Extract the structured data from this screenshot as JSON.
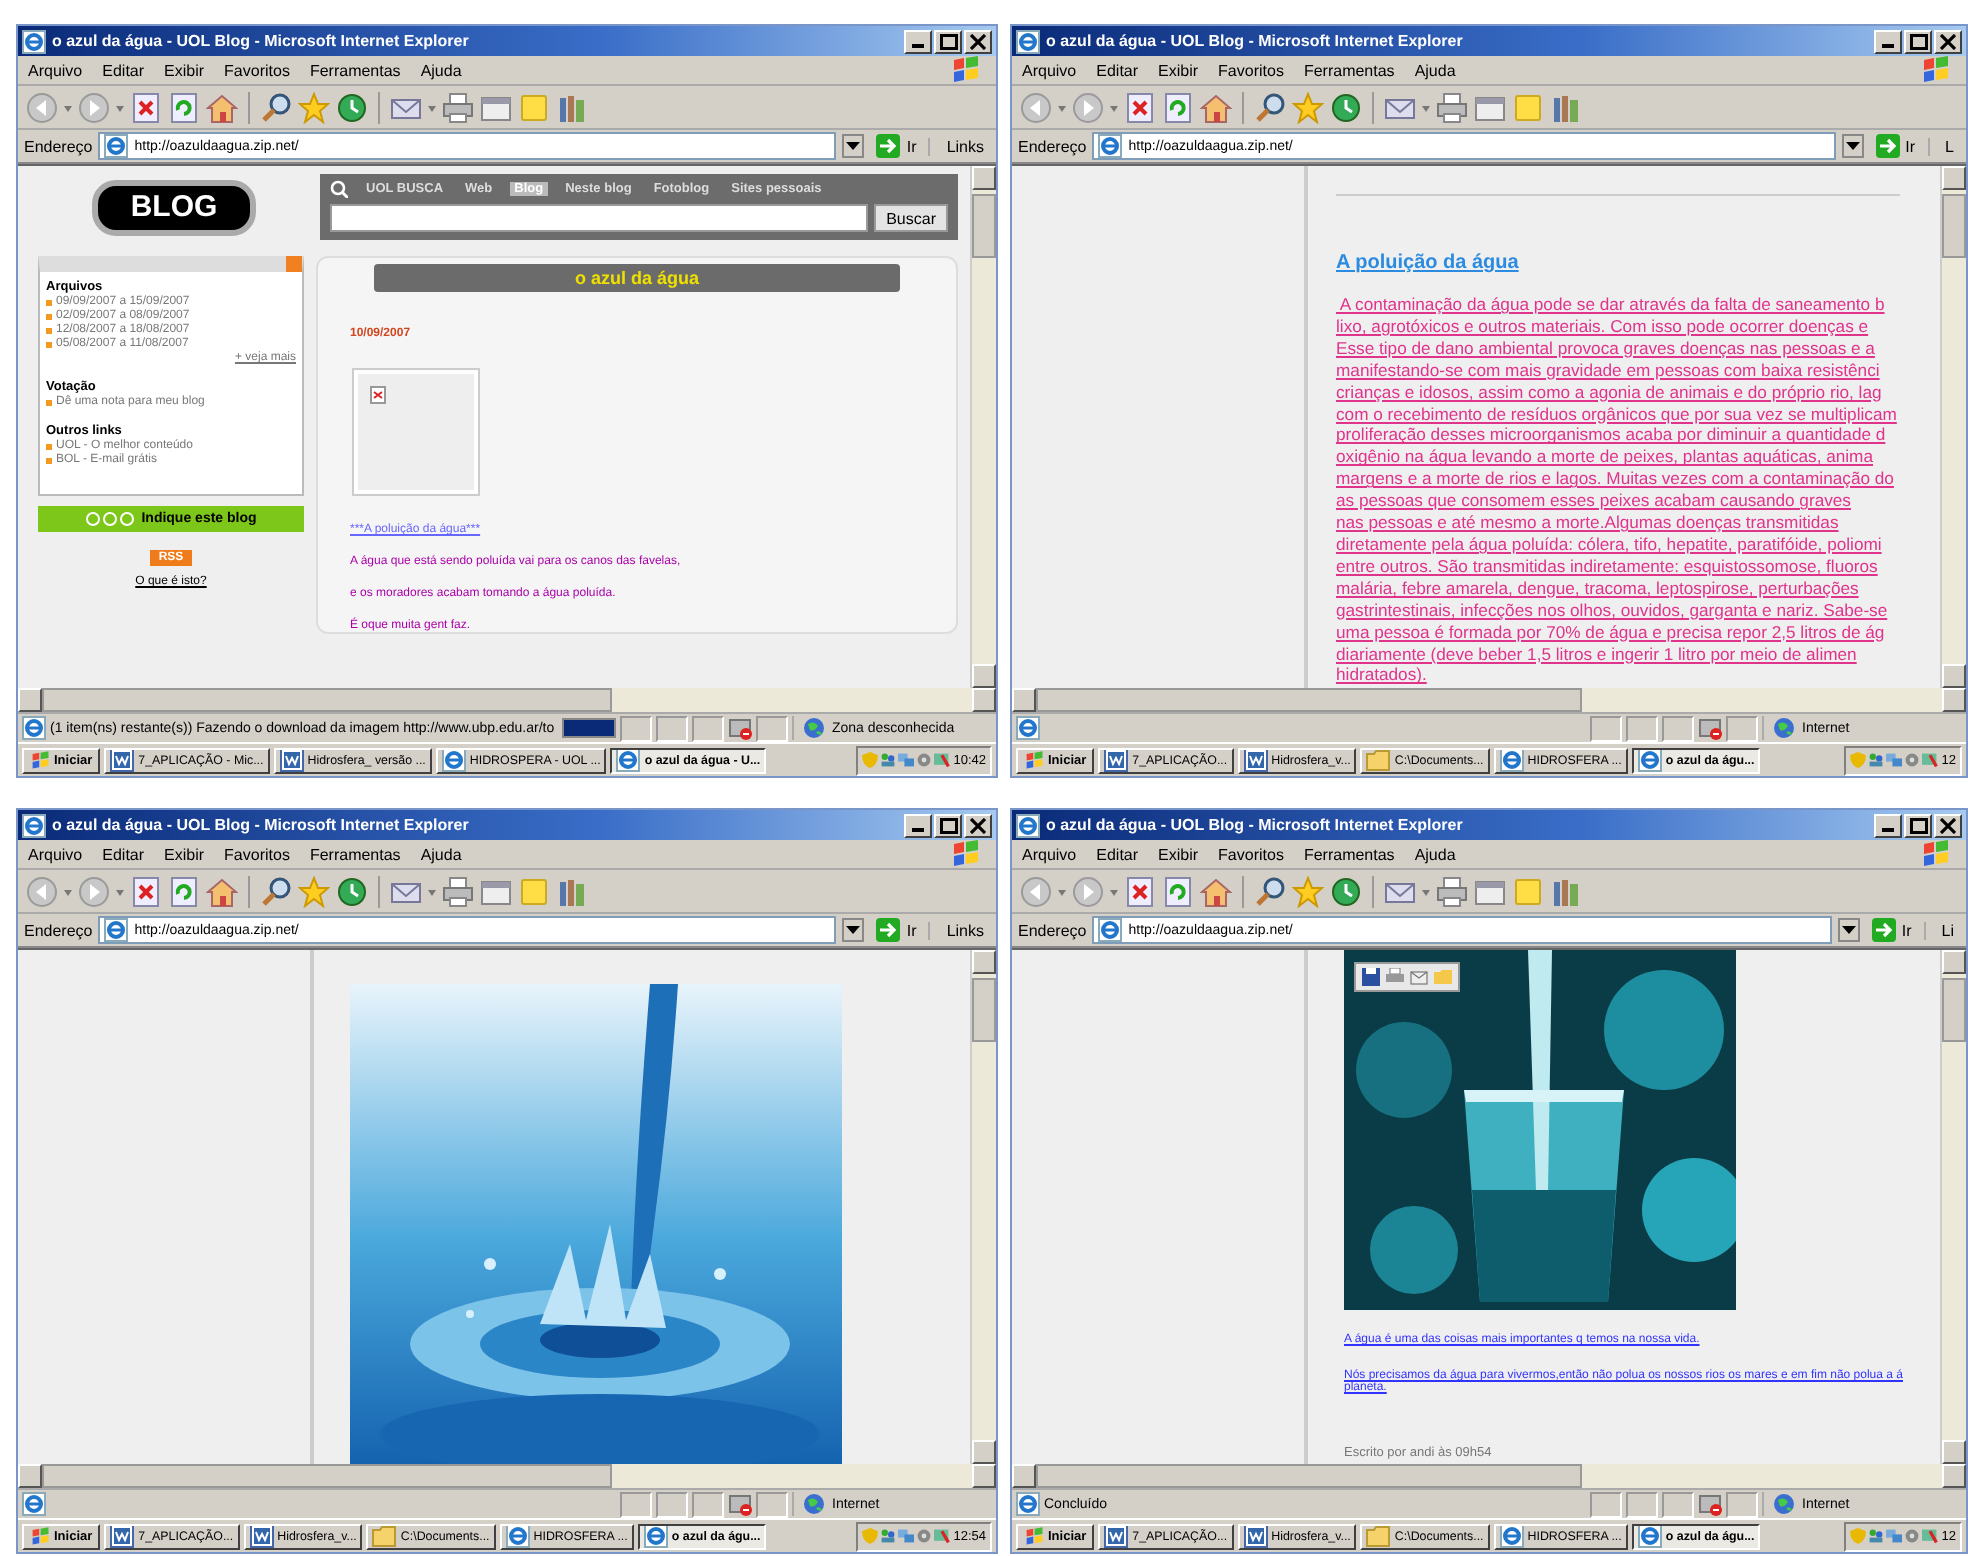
{
  "windows": [
    {
      "title": "o azul da água - UOL Blog - Microsoft Internet Explorer",
      "menu": [
        "Arquivo",
        "Editar",
        "Exibir",
        "Favoritos",
        "Ferramentas",
        "Ajuda"
      ],
      "address_label": "Endereço",
      "url": "http://oazuldaagua.zip.net/",
      "go": "Ir",
      "links": "Links",
      "page": {
        "kind": "blog_home",
        "logo": "BLOG",
        "search": {
          "tabs": [
            {
              "label": "UOL BUSCA",
              "selected": false
            },
            {
              "label": "Web",
              "selected": false
            },
            {
              "label": "Blog",
              "selected": true
            },
            {
              "label": "Neste blog",
              "selected": false
            },
            {
              "label": "Fotoblog",
              "selected": false
            },
            {
              "label": "Sites pessoais",
              "selected": false
            }
          ],
          "button": "Buscar"
        },
        "sidebar": [
          {
            "heading": "Arquivos",
            "items": [
              "09/09/2007 a 15/09/2007",
              "02/09/2007 a 08/09/2007",
              "12/08/2007 a 18/08/2007",
              "05/08/2007 a 11/08/2007"
            ],
            "more": "+ veja mais"
          },
          {
            "heading": "Votação",
            "items": [
              "Dê uma nota para meu blog"
            ]
          },
          {
            "heading": "Outros links",
            "items": [
              "UOL - O melhor conteúdo",
              "BOL - E-mail grátis"
            ]
          }
        ],
        "recommend": "Indique este blog",
        "rss": "RSS",
        "rss_help": "O que é isto?",
        "blog_title": "o azul da água",
        "post": {
          "date": "10/09/2007",
          "link": "***A poluição da água***",
          "paragraphs": [
            "A água que está sendo poluída vai para os canos das favelas,",
            "e os moradores acabam tomando a água poluída.",
            "É oque muita gent faz."
          ]
        }
      },
      "status": {
        "text": "(1 item(ns) restante(s)) Fazendo o download da imagem http://www.ubp.edu.ar/to",
        "progress": {
          "level": 1
        },
        "zone": "Zona desconhecida"
      },
      "taskbar": {
        "start": "Iniciar",
        "items": [
          {
            "label": "7_APLICAÇÃO - Mic...",
            "kind": "word",
            "selected": false
          },
          {
            "label": "Hidrosfera_ versão ...",
            "kind": "word",
            "selected": false
          },
          {
            "label": "HIDROSPERA - UOL ...",
            "kind": "ie",
            "selected": false
          },
          {
            "label": "o azul da água - U...",
            "kind": "ie",
            "selected": true
          }
        ],
        "clock": "10:42"
      }
    },
    {
      "title": "o azul da água - UOL Blog - Microsoft Internet Explorer",
      "menu": [
        "Arquivo",
        "Editar",
        "Exibir",
        "Favoritos",
        "Ferramentas",
        "Ajuda"
      ],
      "address_label": "Endereço",
      "url": "http://oazuldaagua.zip.net/",
      "go": "Ir",
      "links": "L",
      "page": {
        "kind": "article",
        "heading": "A poluição da água",
        "lines": [
          " A contaminação da água pode se dar através da falta de saneamento b",
          "lixo, agrotóxicos e outros materiais. Com isso pode ocorrer doenças e",
          "Esse tipo de dano ambiental provoca graves doenças nas pessoas e a",
          "manifestando-se com mais gravidade em pessoas com baixa resistênci",
          "crianças e idosos, assim como a agonia de animais e do próprio rio, lag",
          "com o recebimento de resíduos orgânicos que por sua vez se multiplicam",
          "proliferação desses microorganismos acaba por diminuir a quantidade d",
          "oxigênio na água levando a morte de peixes, plantas aquáticas, anima",
          "margens e a morte de rios e lagos. Muitas vezes com a contaminação do",
          "as pessoas que consomem esses peixes acabam causando graves",
          "nas pessoas e até mesmo a morte.Algumas doenças transmitidas",
          "diretamente pela água poluída: cólera, tifo, hepatite, paratifóide, poliomi",
          "entre outros. São transmitidas indiretamente: esquistossomose, fluoros",
          "malária, febre amarela, dengue, tracoma, leptospirose, perturbações",
          "gastrintestinais, infecções nos olhos, ouvidos, garganta e nariz. Sabe-se",
          "uma pessoa é formada por 70% de água e precisa repor 2,5 litros de ág",
          "diariamente (deve beber 1,5 litros e ingerir 1 litro por meio de alimen",
          "hidratados)."
        ]
      },
      "status": {
        "zone": "Internet"
      },
      "taskbar": {
        "start": "Iniciar",
        "items": [
          {
            "label": "7_APLICAÇÃO...",
            "kind": "word",
            "selected": false
          },
          {
            "label": "Hidrosfera_v...",
            "kind": "word",
            "selected": false
          },
          {
            "label": "C:\\Documents...",
            "kind": "folder",
            "selected": false
          },
          {
            "label": "HIDROSFERA ...",
            "kind": "ie",
            "selected": false
          },
          {
            "label": "o azul da águ...",
            "kind": "ie",
            "selected": true
          }
        ],
        "clock": "12"
      }
    },
    {
      "title": "o azul da água - UOL Blog - Microsoft Internet Explorer",
      "menu": [
        "Arquivo",
        "Editar",
        "Exibir",
        "Favoritos",
        "Ferramentas",
        "Ajuda"
      ],
      "address_label": "Endereço",
      "url": "http://oazuldaagua.zip.net/",
      "go": "Ir",
      "links": "Links",
      "status": {
        "zone": "Internet"
      },
      "taskbar": {
        "start": "Iniciar",
        "items": [
          {
            "label": "7_APLICAÇÃO...",
            "kind": "word",
            "selected": false
          },
          {
            "label": "Hidrosfera_v...",
            "kind": "word",
            "selected": false
          },
          {
            "label": "C:\\Documents...",
            "kind": "folder",
            "selected": false
          },
          {
            "label": "HIDROSFERA ...",
            "kind": "ie",
            "selected": false
          },
          {
            "label": "o azul da águ...",
            "kind": "ie",
            "selected": true
          }
        ],
        "clock": "12:54"
      }
    },
    {
      "title": "o azul da água - UOL Blog - Microsoft Internet Explorer",
      "menu": [
        "Arquivo",
        "Editar",
        "Exibir",
        "Favoritos",
        "Ferramentas",
        "Ajuda"
      ],
      "address_label": "Endereço",
      "url": "http://oazuldaagua.zip.net/",
      "go": "Ir",
      "links": "Li",
      "page": {
        "kind": "photo_post",
        "captions": [
          [
            "A água é uma das coisas mais importantes q temos na nossa vida."
          ],
          [
            "Nós precisamos da água para vivermos,então não polua os nossos rios os mares e em fim não polua a á",
            "planeta."
          ]
        ],
        "footer": "Escrito por andi às 09h54"
      },
      "status": {
        "text": "Concluído",
        "zone": "Internet"
      },
      "taskbar": {
        "start": "Iniciar",
        "items": [
          {
            "label": "7_APLICAÇÃO...",
            "kind": "word",
            "selected": false
          },
          {
            "label": "Hidrosfera_v...",
            "kind": "word",
            "selected": false
          },
          {
            "label": "C:\\Documents...",
            "kind": "folder",
            "selected": false
          },
          {
            "label": "HIDROSFERA ...",
            "kind": "ie",
            "selected": false
          },
          {
            "label": "o azul da águ...",
            "kind": "ie",
            "selected": true
          }
        ],
        "clock": "12"
      }
    }
  ]
}
